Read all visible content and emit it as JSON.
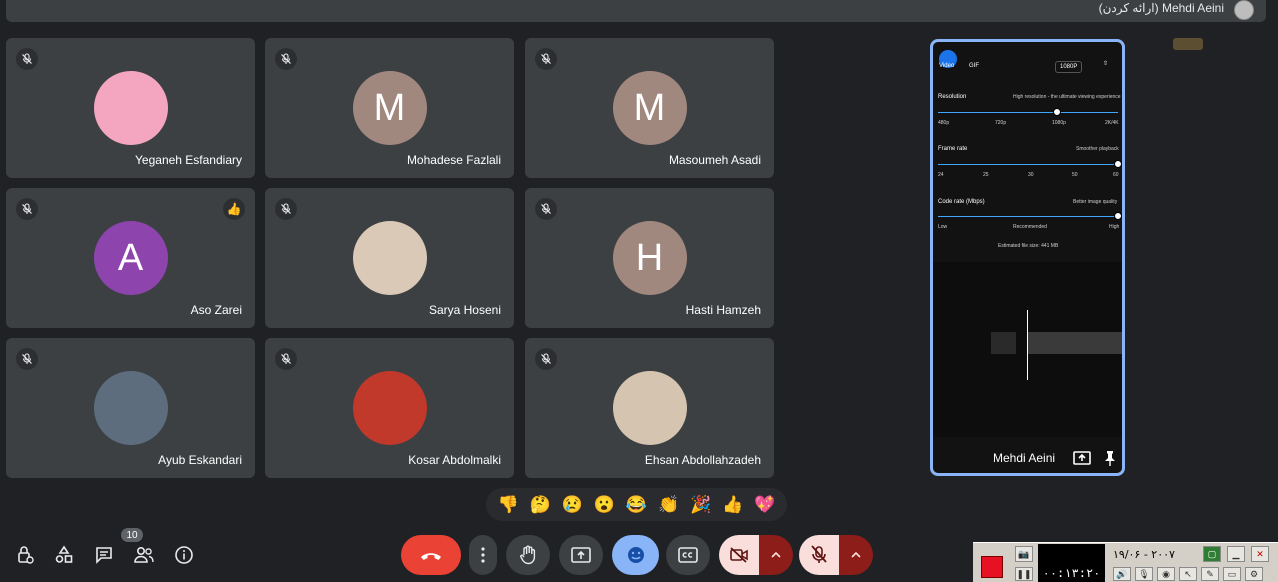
{
  "top_bar": {
    "presenter_label": "(ارائه کردن) Mehdi Aeini"
  },
  "participants": [
    {
      "name": "Yeganeh Esfandiary",
      "initial": "",
      "avatar_color": "#f4a6c0"
    },
    {
      "name": "Mohadese Fazlali",
      "initial": "M",
      "avatar_color": "#a1887f"
    },
    {
      "name": "Masoumeh Asadi",
      "initial": "M",
      "avatar_color": "#a1887f"
    },
    {
      "name": "Aso Zarei",
      "initial": "A",
      "avatar_color": "#8e44ad"
    },
    {
      "name": "Sarya Hoseni",
      "initial": "",
      "avatar_color": "#d9c9b6"
    },
    {
      "name": "Hasti Hamzeh",
      "initial": "H",
      "avatar_color": "#a1887f"
    },
    {
      "name": "Ayub Eskandari",
      "initial": "",
      "avatar_color": "#5d6d7e"
    },
    {
      "name": "Kosar Abdolmalki",
      "initial": "",
      "avatar_color": "#c0392b"
    },
    {
      "name": "Ehsan Abdollahzadeh",
      "initial": "",
      "avatar_color": "#d5c4b0"
    }
  ],
  "reaction_on_aso": "👍",
  "shared_screen": {
    "presenter_name": "Mehdi Aeini",
    "tabs": [
      "Video",
      "GIF"
    ],
    "quality_button": "1080P",
    "resolution_title": "Resolution",
    "resolution_hint": "High resolution - the ultimate viewing experience",
    "resolution_ticks": [
      "480p",
      "720p",
      "1080p",
      "2K/4K"
    ],
    "resolution_value": 0.66,
    "frame_title": "Frame rate",
    "frame_hint": "Smoother playback",
    "frame_ticks": [
      "24",
      "25",
      "30",
      "50",
      "60"
    ],
    "frame_value": 1.0,
    "code_title": "Code rate (Mbps)",
    "code_hint": "Better image quality",
    "code_ticks": [
      "Low",
      "Recommended",
      "High"
    ],
    "code_value": 1.0,
    "file_size": "Estimated file size: 441 MB"
  },
  "reactions": [
    "👎",
    "🤔",
    "😢",
    "😮",
    "😂",
    "👏",
    "🎉",
    "👍",
    "💖"
  ],
  "toolbar": {
    "people_count": "10"
  },
  "widget": {
    "date": "۱۹/۰۶ - ۲۰۰۷",
    "clock": "۰۰:۱۳:۲۰"
  },
  "colors": {
    "hangup": "#ea4335",
    "accent": "#8ab4f8",
    "emoji_active": "#8ab4f8",
    "mic_off": "#f28b82"
  }
}
